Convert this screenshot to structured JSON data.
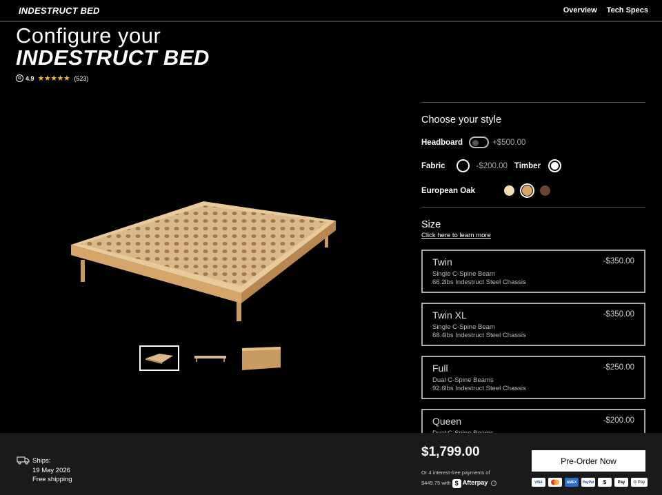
{
  "nav": {
    "brand": "INDESTRUCT BED",
    "links": [
      "Overview",
      "Tech Specs"
    ]
  },
  "hero": {
    "title_line1": "Configure your",
    "title_line2": "INDESTRUCT BED",
    "rating": "4.9",
    "stars": "★★★★★",
    "star_value": 4.9,
    "reviews": "(523)"
  },
  "gallery": {
    "thumbnails": 3,
    "active_index": 0
  },
  "style": {
    "title": "Choose your style",
    "headboard_label": "Headboard",
    "headboard_enabled": false,
    "headboard_price": "+$500.00",
    "fabric_label": "Fabric",
    "fabric_price": "-$200.00",
    "timber_label": "Timber",
    "selected_material": "Timber",
    "wood_label": "European Oak",
    "swatches": [
      {
        "name": "light-oak",
        "color": "#f3ddb3",
        "selected": false
      },
      {
        "name": "european-oak",
        "color": "#d9a363",
        "selected": true
      },
      {
        "name": "walnut",
        "color": "#6b4530",
        "selected": false
      }
    ]
  },
  "size": {
    "title": "Size",
    "learn_more": "Click here to learn more",
    "options": [
      {
        "name": "Twin",
        "line1": "Single C-Spine Beam",
        "line2": "66.2lbs Indestruct Steel Chassis",
        "price": "-$350.00"
      },
      {
        "name": "Twin XL",
        "line1": "Single C-Spine Beam",
        "line2": "68.4lbs Indestruct Steel Chassis",
        "price": "-$350.00"
      },
      {
        "name": "Full",
        "line1": "Dual C-Spine Beams",
        "line2": "92.6lbs Indestruct Steel Chassis",
        "price": "-$250.00"
      },
      {
        "name": "Queen",
        "line1": "Dual C-Spine Beams",
        "line2": "",
        "price": "-$200.00"
      }
    ]
  },
  "footer": {
    "ships_label": "Ships:",
    "ship_date": "19 May 2026",
    "shipping": "Free shipping",
    "total": "$1,799.00",
    "installment_line1": "Or 4 interest-free payments of",
    "installment_amount": "$449.75 with",
    "afterpay": "Afterpay",
    "preorder": "Pre-Order Now",
    "payment_methods": [
      "VISA",
      "MC",
      "AMEX",
      "PayPal",
      "$",
      "Pay",
      "G Pay"
    ]
  },
  "colors": {
    "background": "#000000",
    "bottom_bar": "#1a1a1a",
    "star": "#f5b942",
    "button": "#ffffff"
  }
}
